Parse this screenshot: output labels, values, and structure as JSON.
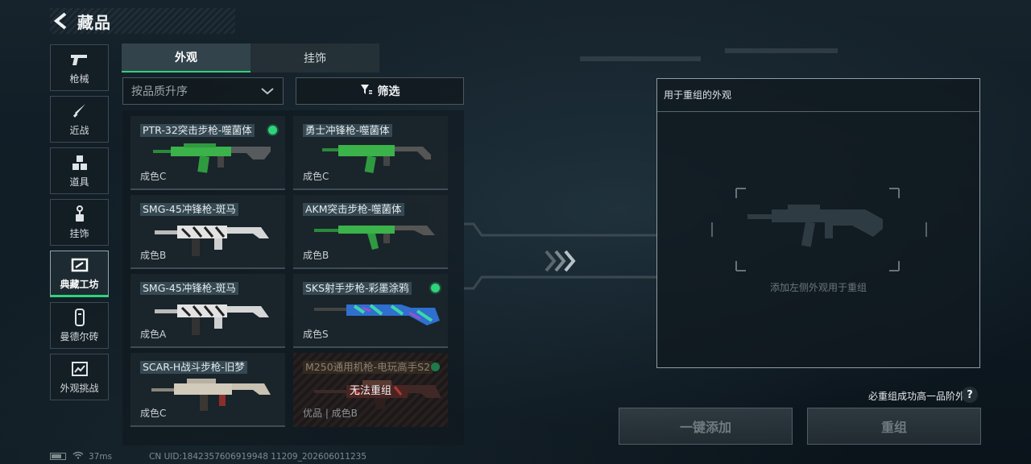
{
  "header": {
    "title": "藏品"
  },
  "nav": {
    "items": [
      {
        "label": "枪械"
      },
      {
        "label": "近战"
      },
      {
        "label": "道具"
      },
      {
        "label": "挂饰"
      },
      {
        "label": "典藏工坊"
      },
      {
        "label": "曼德尔砖"
      },
      {
        "label": "外观挑战"
      }
    ],
    "active_index": 4
  },
  "tabs": [
    {
      "label": "外观"
    },
    {
      "label": "挂饰"
    }
  ],
  "sort": {
    "label": "按品质升序"
  },
  "filter": {
    "label": "筛选"
  },
  "cards": [
    {
      "title": "PTR-32突击步枪-噬菌体",
      "grade": "成色C",
      "dot": true
    },
    {
      "title": "勇士冲锋枪-噬菌体",
      "grade": "成色C",
      "dot": false
    },
    {
      "title": "SMG-45冲锋枪-斑马",
      "grade": "成色B",
      "dot": false
    },
    {
      "title": "AKM突击步枪-噬菌体",
      "grade": "成色B",
      "dot": false
    },
    {
      "title": "SMG-45冲锋枪-斑马",
      "grade": "成色A",
      "dot": false
    },
    {
      "title": "SKS射手步枪-彩墨涂鸦",
      "grade": "成色S",
      "dot": true
    },
    {
      "title": "SCAR-H战斗步枪-旧梦",
      "grade": "成色C",
      "dot": false
    },
    {
      "title": "M250通用机枪-电玩高手S2",
      "grade": "优品 | 成色B",
      "dot": true,
      "overlay": "无法重组",
      "disabled": true
    }
  ],
  "target": {
    "title": "用于重组的外观",
    "hint": "添加左侧外观用于重组"
  },
  "note": "必重组成功高一品阶外观",
  "buttons": {
    "add": "一键添加",
    "rebuild": "重组"
  },
  "status": {
    "ping": "37ms",
    "uid": "CN UID:1842357606919948 11209_202606011235"
  },
  "colors": {
    "accent": "#2fd37a",
    "panel_border": "#8e9ca3"
  }
}
